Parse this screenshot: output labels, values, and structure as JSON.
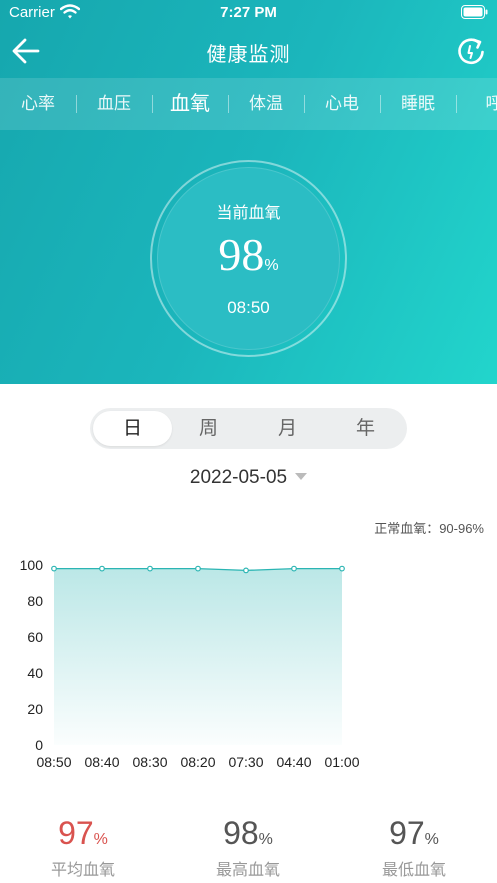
{
  "status_bar": {
    "carrier": "Carrier",
    "time": "7:27 PM"
  },
  "nav": {
    "title": "健康监测",
    "back_icon": "arrow-left-icon",
    "refresh_icon": "refresh-icon"
  },
  "tabs": [
    {
      "label": "心率"
    },
    {
      "label": "血压"
    },
    {
      "label": "血氧",
      "active": true
    },
    {
      "label": "体温"
    },
    {
      "label": "心电"
    },
    {
      "label": "睡眠"
    },
    {
      "label": "呼"
    }
  ],
  "current": {
    "label": "当前血氧",
    "value": "98",
    "unit": "%",
    "time": "08:50"
  },
  "periods": [
    "日",
    "周",
    "月",
    "年"
  ],
  "selected_period": "日",
  "date": "2022-05-05",
  "normal_range": "正常血氧：90-96%",
  "chart_data": {
    "type": "area",
    "x": [
      "08:50",
      "08:40",
      "08:30",
      "08:20",
      "07:30",
      "04:40",
      "01:00"
    ],
    "series": [
      {
        "values": [
          98,
          98,
          98,
          98,
          97,
          98,
          98
        ]
      }
    ],
    "yticks": [
      "100",
      "80",
      "60",
      "40",
      "20",
      "0"
    ],
    "ylim": [
      0,
      100
    ],
    "grid": false,
    "color": "#2bb5b3"
  },
  "stats": [
    {
      "value": "97",
      "unit": "%",
      "label": "平均血氧",
      "color": "#d9534f"
    },
    {
      "value": "98",
      "unit": "%",
      "label": "最高血氧",
      "color": "#555555"
    },
    {
      "value": "97",
      "unit": "%",
      "label": "最低血氧",
      "color": "#555555"
    }
  ],
  "colors": {
    "header": "#1bb6bc",
    "accent": "#2bb5b3"
  }
}
